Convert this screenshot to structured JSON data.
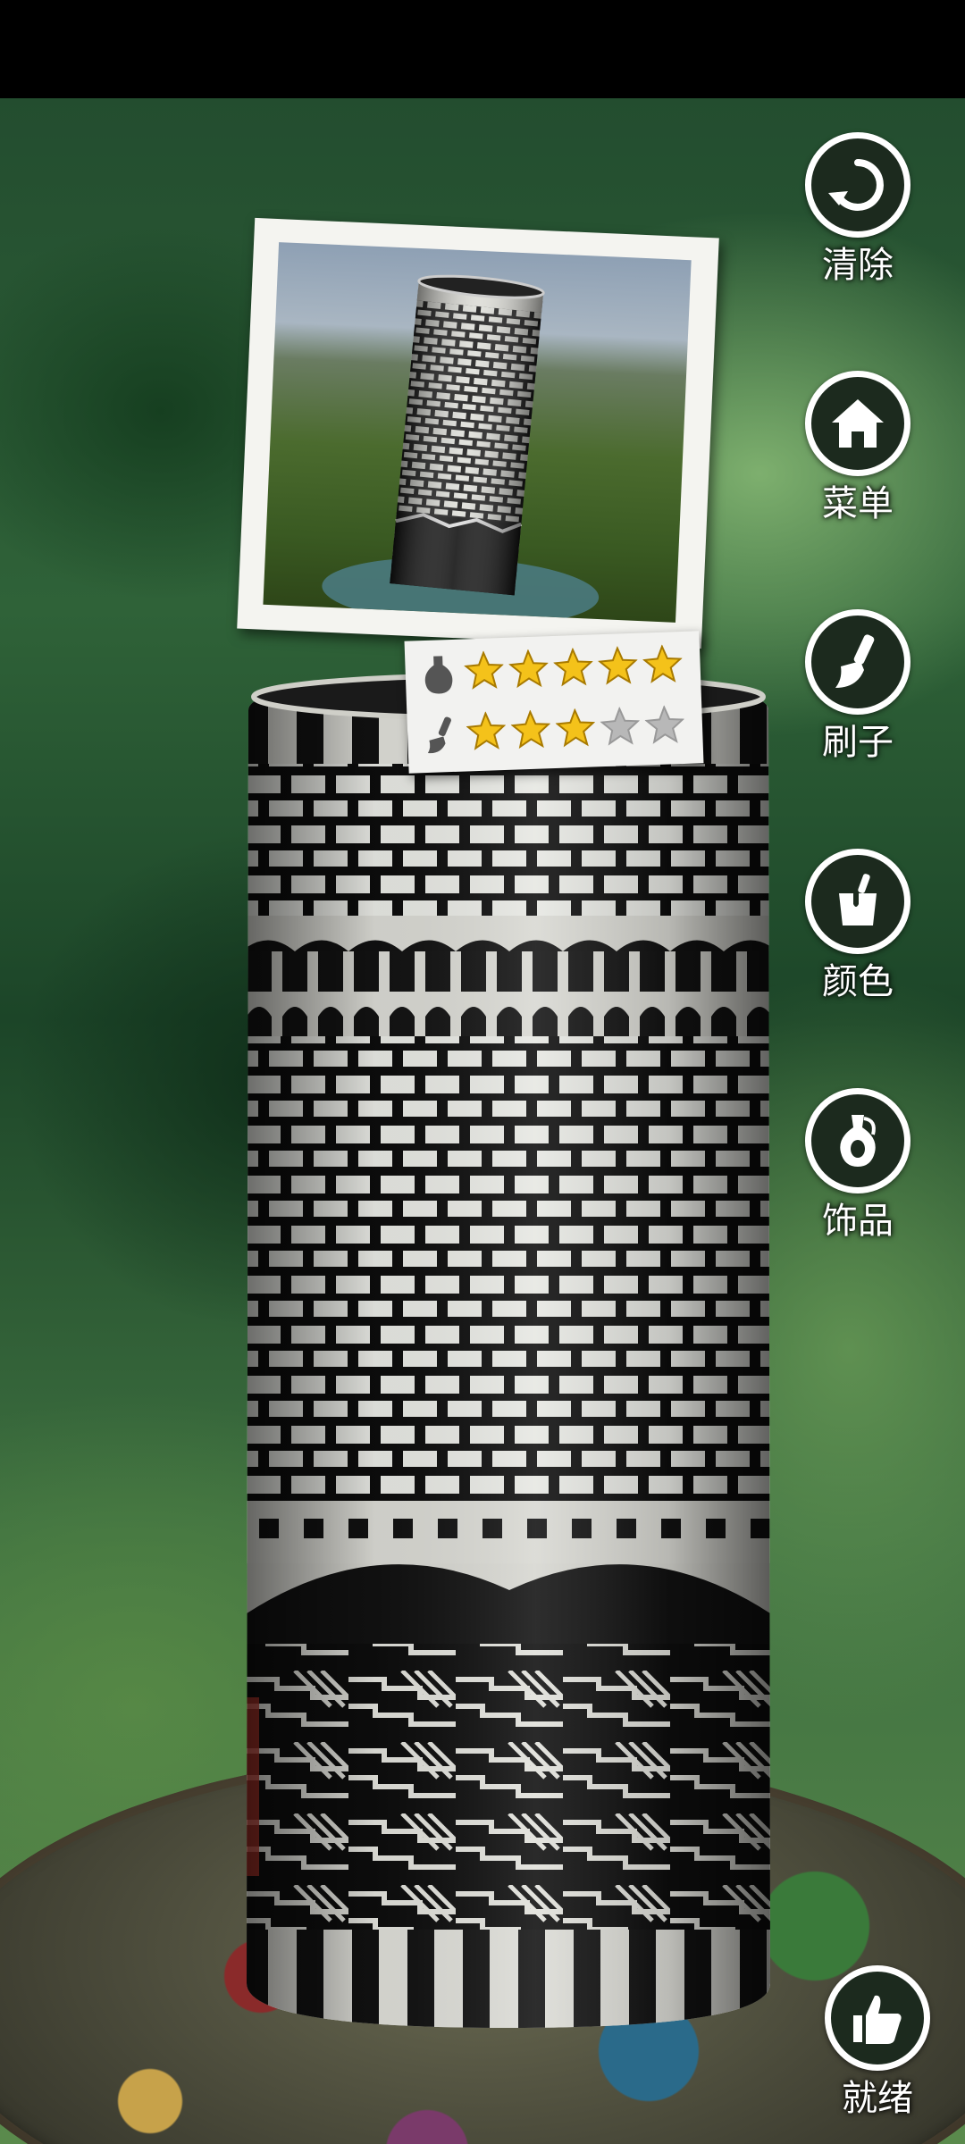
{
  "menu": {
    "clear": {
      "label": "清除",
      "icon": "refresh-icon"
    },
    "menu": {
      "label": "菜单",
      "icon": "home-icon"
    },
    "brush": {
      "label": "刷子",
      "icon": "brush-icon"
    },
    "color": {
      "label": "颜色",
      "icon": "paint-bucket-icon"
    },
    "decoration": {
      "label": "饰品",
      "icon": "vase-icon"
    }
  },
  "ready": {
    "label": "就绪",
    "icon": "thumbs-up-icon"
  },
  "target_card": {
    "shape_rating": {
      "icon": "vase-icon",
      "stars": 5,
      "max": 5
    },
    "paint_rating": {
      "icon": "brush-icon",
      "stars": 3,
      "max": 5
    }
  },
  "colors": {
    "star_filled": "#f4c21a",
    "star_empty": "#b8b8b8",
    "button_ring": "#ffffff",
    "button_fill": "#1c2a1e"
  }
}
